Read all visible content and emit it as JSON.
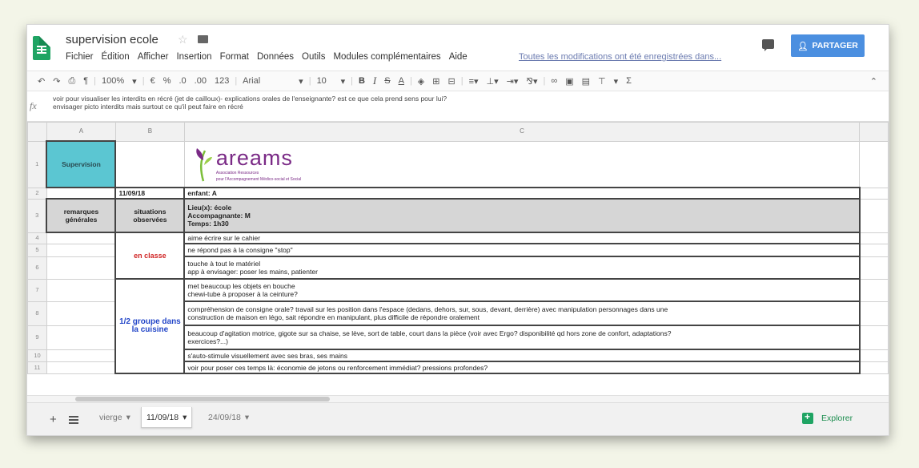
{
  "header": {
    "title": "supervision  ecole",
    "menu": [
      "Fichier",
      "Édition",
      "Afficher",
      "Insertion",
      "Format",
      "Données",
      "Outils",
      "Modules complémentaires",
      "Aide"
    ],
    "save_status": "Toutes les modifications ont été enregistrées dans...",
    "share_label": "PARTAGER",
    "share_icon": "person-icon",
    "accent_color": "#4b8fe0"
  },
  "toolbar": {
    "zoom": "100%",
    "currency": "€",
    "percent": "%",
    "decimal_less": ".0",
    "decimal_more": ".00",
    "number_format": "123",
    "font": "Arial",
    "font_size": "10",
    "bold": "B",
    "italic": "I",
    "strike": "S",
    "text_color": "A",
    "more": "▾",
    "functions": "Σ"
  },
  "formula_bar": {
    "fx": "fx",
    "line1": "voir pour visualiser les interdits en récré (jet de cailloux)- explications orales de l'enseignante? est ce que cela prend sens pour lui?",
    "line2": "envisager picto interdits mais surtout ce qu'il peut faire en récré"
  },
  "grid": {
    "columns": [
      "A",
      "B",
      "C"
    ],
    "row_numbers": [
      "1",
      "2",
      "3",
      "4",
      "5",
      "6",
      "7",
      "8",
      "9",
      "10",
      "11"
    ],
    "a1": "Supervision",
    "logo_text": "areams",
    "logo_sub1": "Association Ressources",
    "logo_sub2": "pour l'Accompagnement Médico-social et Social",
    "b2": "11/09/18",
    "c2": "enfant: A",
    "a3": "remarques générales",
    "b3": "situations observées",
    "c3_line1": "Lieu(x): école",
    "c3_line2": "Accompagnante: M",
    "c3_line3": "Temps: 1h30",
    "category1": "en classe",
    "category2": "1/2 groupe dans la cuisine",
    "c4": "aime écrire sur le cahier",
    "c5": "ne répond pas à la consigne \"stop\"",
    "c6_line1": "touche à tout le matériel",
    "c6_line2": "app à envisager: poser les mains, patienter",
    "c7_line1": "met beaucoup les objets en bouche",
    "c7_line2": "chewi-tube à proposer à la ceinture?",
    "c8_line1": "compréhension de consigne orale? travail sur les position dans l'espace (dedans, dehors, sur, sous, devant, derrière) avec manipulation personnages dans une",
    "c8_line2": "construction de maison en légo, sait répondre en manipulant, plus difficile de répondre oralement",
    "c9_line1": "beaucoup d'agitation motrice, gigote sur sa chaise, se lève, sort de table, court dans la pièce (voir avec Ergo? disponibilité qd hors zone de confort, adaptations?",
    "c9_line2": "exercices?...)",
    "c10": "s'auto-stimule visuellement avec ses bras, ses mains",
    "c11": "voir pour poser ces temps là: économie de jetons ou renforcement immédiat? pressions profondes?",
    "supervision_color": "#5bc6d2",
    "category1_color": "#d02525",
    "category2_color": "#2346c8"
  },
  "sheet_tabs": {
    "add": "+",
    "tabs": [
      "vierge",
      "11/09/18",
      "24/09/18"
    ],
    "active_tab": "11/09/18",
    "explore": "Explorer"
  }
}
